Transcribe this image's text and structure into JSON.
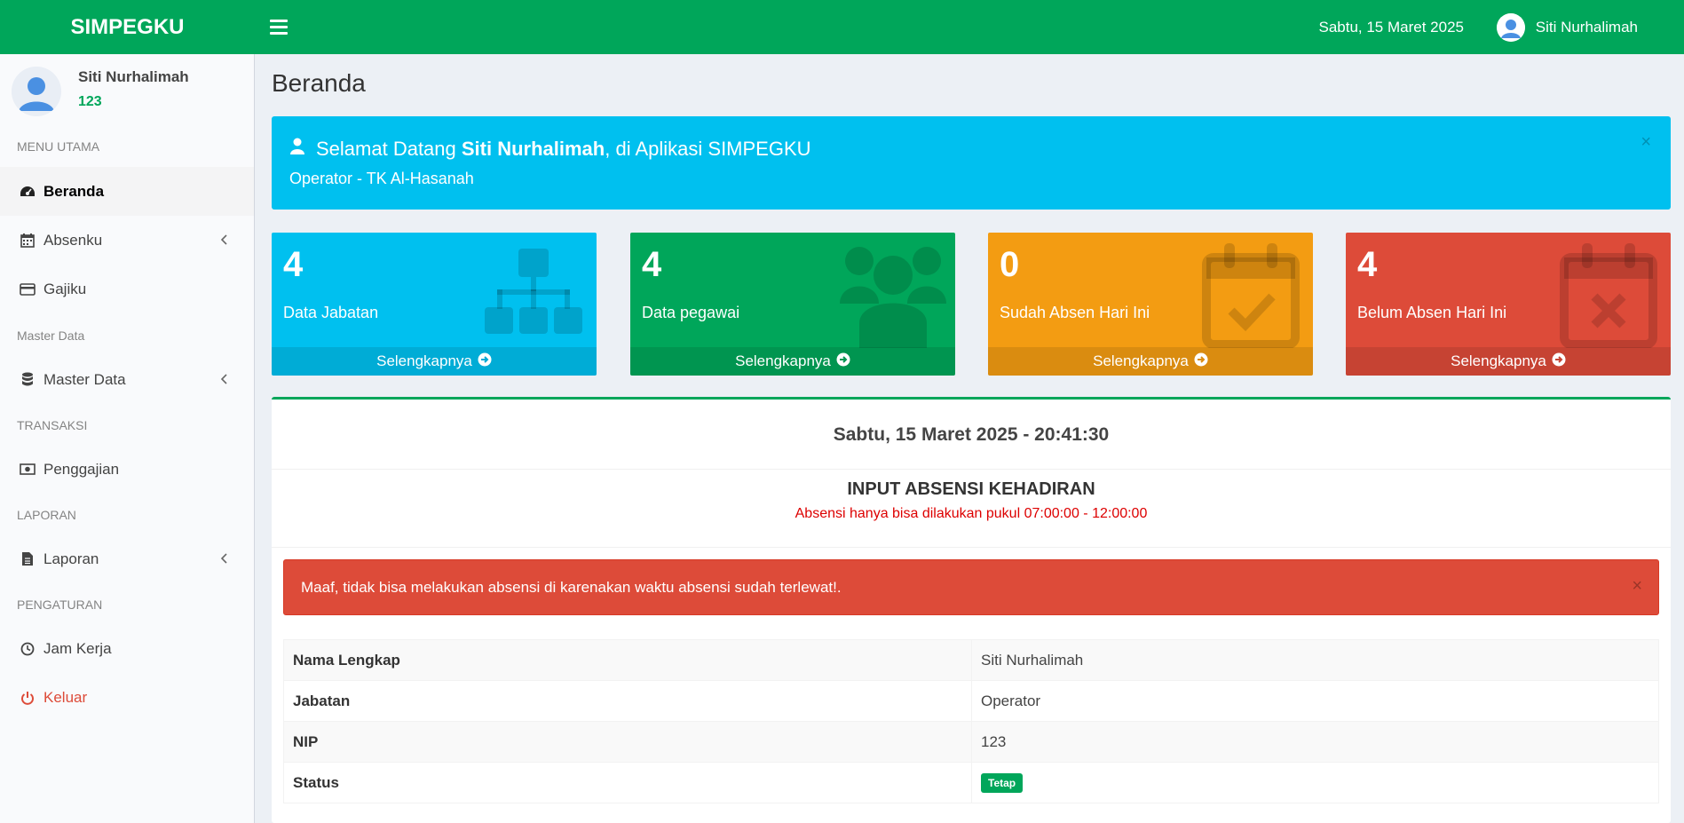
{
  "header": {
    "brand": "SIMPEGKU",
    "date": "Sabtu, 15 Maret 2025",
    "user_name": "Siti Nurhalimah"
  },
  "sidebar": {
    "user": {
      "name": "Siti Nurhalimah",
      "nip": "123"
    },
    "sections": {
      "menu_utama": "MENU UTAMA",
      "master_data": "Master Data",
      "transaksi": "TRANSAKSI",
      "laporan": "LAPORAN",
      "pengaturan": "PENGATURAN"
    },
    "items": {
      "beranda": {
        "label": "Beranda",
        "icon": "dashboard-icon"
      },
      "absenku": {
        "label": "Absenku",
        "icon": "calendar-icon"
      },
      "gajiku": {
        "label": "Gajiku",
        "icon": "credit-card-icon"
      },
      "master_data": {
        "label": "Master Data",
        "icon": "database-icon"
      },
      "penggajian": {
        "label": "Penggajian",
        "icon": "money-icon"
      },
      "laporan": {
        "label": "Laporan",
        "icon": "file-icon"
      },
      "jam_kerja": {
        "label": "Jam Kerja",
        "icon": "clock-icon"
      },
      "keluar": {
        "label": "Keluar",
        "icon": "power-icon"
      }
    }
  },
  "page": {
    "title": "Beranda"
  },
  "welcome": {
    "prefix": "Selamat Datang ",
    "name": "Siti Nurhalimah",
    "suffix": ", di Aplikasi SIMPEGKU",
    "subtitle": "Operator - TK Al-Hasanah",
    "close": "×"
  },
  "stats": [
    {
      "value": "4",
      "label": "Data Jabatan",
      "link": "Selengkapnya",
      "color": "#00c0ef",
      "icon": "sitemap-icon"
    },
    {
      "value": "4",
      "label": "Data pegawai",
      "link": "Selengkapnya",
      "color": "#00a65a",
      "icon": "users-icon"
    },
    {
      "value": "0",
      "label": "Sudah Absen Hari Ini",
      "link": "Selengkapnya",
      "color": "#f39c12",
      "icon": "calendar-check-icon"
    },
    {
      "value": "4",
      "label": "Belum Absen Hari Ini",
      "link": "Selengkapnya",
      "color": "#dd4b39",
      "icon": "calendar-times-icon"
    }
  ],
  "attendance": {
    "clock": "Sabtu, 15 Maret 2025 - 20:41:30",
    "title": "INPUT ABSENSI KEHADIRAN",
    "note": "Absensi hanya bisa dilakukan pukul 07:00:00 - 12:00:00",
    "alert": "Maaf, tidak bisa melakukan absensi di karenakan waktu absensi sudah terlewat!.",
    "alert_close": "×",
    "rows": [
      {
        "key": "Nama Lengkap",
        "value": "Siti Nurhalimah"
      },
      {
        "key": "Jabatan",
        "value": "Operator"
      },
      {
        "key": "NIP",
        "value": "123"
      },
      {
        "key": "Status",
        "value": "Tetap"
      }
    ]
  }
}
